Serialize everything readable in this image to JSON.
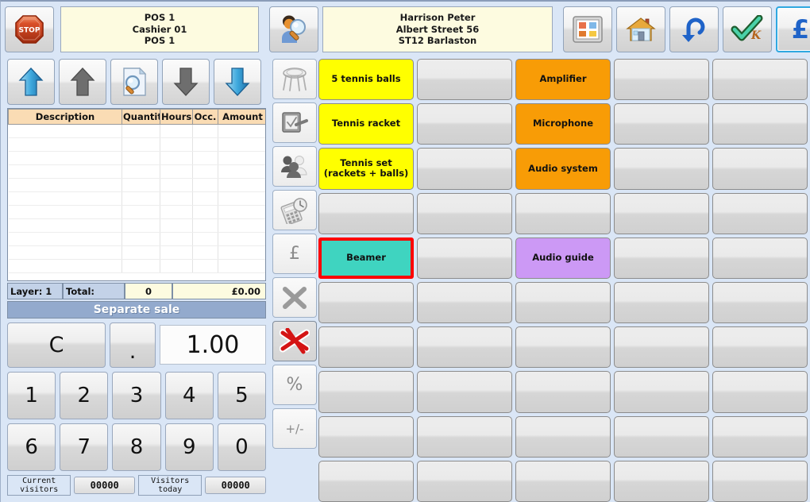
{
  "topbar": {
    "stop_button": {
      "label": "STOP",
      "icon": "stop-sign-icon"
    },
    "pos_info": {
      "line1": "POS 1",
      "line2": "Cashier 01",
      "line3": "POS 1"
    },
    "customer_search_icon": "customer-search-icon",
    "customer_info": {
      "line1": "Harrison  Peter",
      "line2": "Albert Street 56",
      "line3": "ST12 Barlaston"
    },
    "buttons": [
      {
        "name": "window-list-icon",
        "label": ""
      },
      {
        "name": "home-icon",
        "label": ""
      },
      {
        "name": "undo-arrow-icon",
        "label": ""
      },
      {
        "name": "ok-check-icon",
        "label": "OK"
      },
      {
        "name": "pound-currency-icon",
        "label": "£",
        "focused": true
      }
    ]
  },
  "left_panel": {
    "nav_buttons": [
      {
        "name": "scroll-top-arrow-icon",
        "state": "enabled"
      },
      {
        "name": "scroll-up-arrow-icon",
        "state": "disabled"
      },
      {
        "name": "document-search-icon",
        "state": "enabled"
      },
      {
        "name": "scroll-down-arrow-icon",
        "state": "disabled"
      },
      {
        "name": "scroll-bottom-arrow-icon",
        "state": "enabled"
      }
    ],
    "table": {
      "columns": [
        "Description",
        "Quantity",
        "Hours",
        "Occ.",
        "Amount"
      ],
      "rows": [],
      "empty_row_count": 11
    },
    "totals": {
      "layer_label": "Layer: 1",
      "total_label": "Total:",
      "quantity": "0",
      "amount": "£0.00"
    },
    "separate_sale_label": "Separate sale",
    "keypad": {
      "clear_label": "C",
      "decimal_label": ".",
      "display_value": "1.00",
      "digits_row1": [
        "1",
        "2",
        "3",
        "4",
        "5"
      ],
      "digits_row2": [
        "6",
        "7",
        "8",
        "9",
        "0"
      ]
    },
    "footer": {
      "current_visitors_label_line1": "Current",
      "current_visitors_label_line2": "visitors",
      "current_visitors_value": "00000",
      "visitors_today_label_line1": "Visitors",
      "visitors_today_label_line2": "today",
      "visitors_today_value": "00000"
    }
  },
  "mid_column": [
    {
      "name": "bar-stool-icon",
      "label": "",
      "type": "icon",
      "pressed": false
    },
    {
      "name": "signature-tablet-icon",
      "label": "",
      "type": "icon",
      "pressed": false
    },
    {
      "name": "customer-group-icon",
      "label": "",
      "type": "icon",
      "pressed": false
    },
    {
      "name": "calculator-clock-icon",
      "label": "",
      "type": "icon",
      "pressed": false
    },
    {
      "name": "pound-price-icon",
      "label": "£",
      "type": "text",
      "pressed": false
    },
    {
      "name": "multiply-icon",
      "label": "✕",
      "type": "text",
      "pressed": false
    },
    {
      "name": "cancel-line-icon",
      "label": "",
      "type": "icon",
      "pressed": true
    },
    {
      "name": "percent-discount-icon",
      "label": "%",
      "type": "text",
      "pressed": false
    },
    {
      "name": "plus-minus-icon",
      "label": "+/-",
      "type": "text-sm",
      "pressed": false
    }
  ],
  "product_grid": {
    "columns": 5,
    "rows": 10,
    "buttons": [
      {
        "label": "5 tennis balls",
        "color": "yellow",
        "selected": false
      },
      {
        "label": "",
        "color": "empty",
        "selected": false
      },
      {
        "label": "Amplifier",
        "color": "orange",
        "selected": false
      },
      {
        "label": "",
        "color": "empty",
        "selected": false
      },
      {
        "label": "",
        "color": "empty",
        "selected": false
      },
      {
        "label": "Tennis racket",
        "color": "yellow",
        "selected": false
      },
      {
        "label": "",
        "color": "empty",
        "selected": false
      },
      {
        "label": "Microphone",
        "color": "orange",
        "selected": false
      },
      {
        "label": "",
        "color": "empty",
        "selected": false
      },
      {
        "label": "",
        "color": "empty",
        "selected": false
      },
      {
        "label": "Tennis set (rackets + balls)",
        "color": "yellow",
        "selected": false
      },
      {
        "label": "",
        "color": "empty",
        "selected": false
      },
      {
        "label": "Audio system",
        "color": "orange",
        "selected": false
      },
      {
        "label": "",
        "color": "empty",
        "selected": false
      },
      {
        "label": "",
        "color": "empty",
        "selected": false
      },
      {
        "label": "",
        "color": "empty",
        "selected": false
      },
      {
        "label": "",
        "color": "empty",
        "selected": false
      },
      {
        "label": "",
        "color": "empty",
        "selected": false
      },
      {
        "label": "",
        "color": "empty",
        "selected": false
      },
      {
        "label": "",
        "color": "empty",
        "selected": false
      },
      {
        "label": "Beamer",
        "color": "turquoise",
        "selected": true
      },
      {
        "label": "",
        "color": "empty",
        "selected": false
      },
      {
        "label": "Audio guide",
        "color": "purple",
        "selected": false
      },
      {
        "label": "",
        "color": "empty",
        "selected": false
      },
      {
        "label": "",
        "color": "empty",
        "selected": false
      },
      {
        "label": "",
        "color": "empty",
        "selected": false
      },
      {
        "label": "",
        "color": "empty",
        "selected": false
      },
      {
        "label": "",
        "color": "empty",
        "selected": false
      },
      {
        "label": "",
        "color": "empty",
        "selected": false
      },
      {
        "label": "",
        "color": "empty",
        "selected": false
      },
      {
        "label": "",
        "color": "empty",
        "selected": false
      },
      {
        "label": "",
        "color": "empty",
        "selected": false
      },
      {
        "label": "",
        "color": "empty",
        "selected": false
      },
      {
        "label": "",
        "color": "empty",
        "selected": false
      },
      {
        "label": "",
        "color": "empty",
        "selected": false
      },
      {
        "label": "",
        "color": "empty",
        "selected": false
      },
      {
        "label": "",
        "color": "empty",
        "selected": false
      },
      {
        "label": "",
        "color": "empty",
        "selected": false
      },
      {
        "label": "",
        "color": "empty",
        "selected": false
      },
      {
        "label": "",
        "color": "empty",
        "selected": false
      },
      {
        "label": "",
        "color": "empty",
        "selected": false
      },
      {
        "label": "",
        "color": "empty",
        "selected": false
      },
      {
        "label": "",
        "color": "empty",
        "selected": false
      },
      {
        "label": "",
        "color": "empty",
        "selected": false
      },
      {
        "label": "",
        "color": "empty",
        "selected": false
      },
      {
        "label": "",
        "color": "empty",
        "selected": false
      },
      {
        "label": "",
        "color": "empty",
        "selected": false
      },
      {
        "label": "",
        "color": "empty",
        "selected": false
      },
      {
        "label": "",
        "color": "empty",
        "selected": false
      },
      {
        "label": "",
        "color": "empty",
        "selected": false
      }
    ]
  },
  "colors": {
    "app_background": "#dae6f6",
    "info_panel": "#fdfbe0",
    "table_header": "#fadcb4",
    "separate_sale_bar": "#93aacd",
    "product_yellow": "#ffff00",
    "product_orange": "#f89c06",
    "product_turquoise": "#3fd4c0",
    "product_purple": "#cc99f5",
    "selection_border": "#fe0000",
    "focus_border": "#2fa8e0"
  }
}
